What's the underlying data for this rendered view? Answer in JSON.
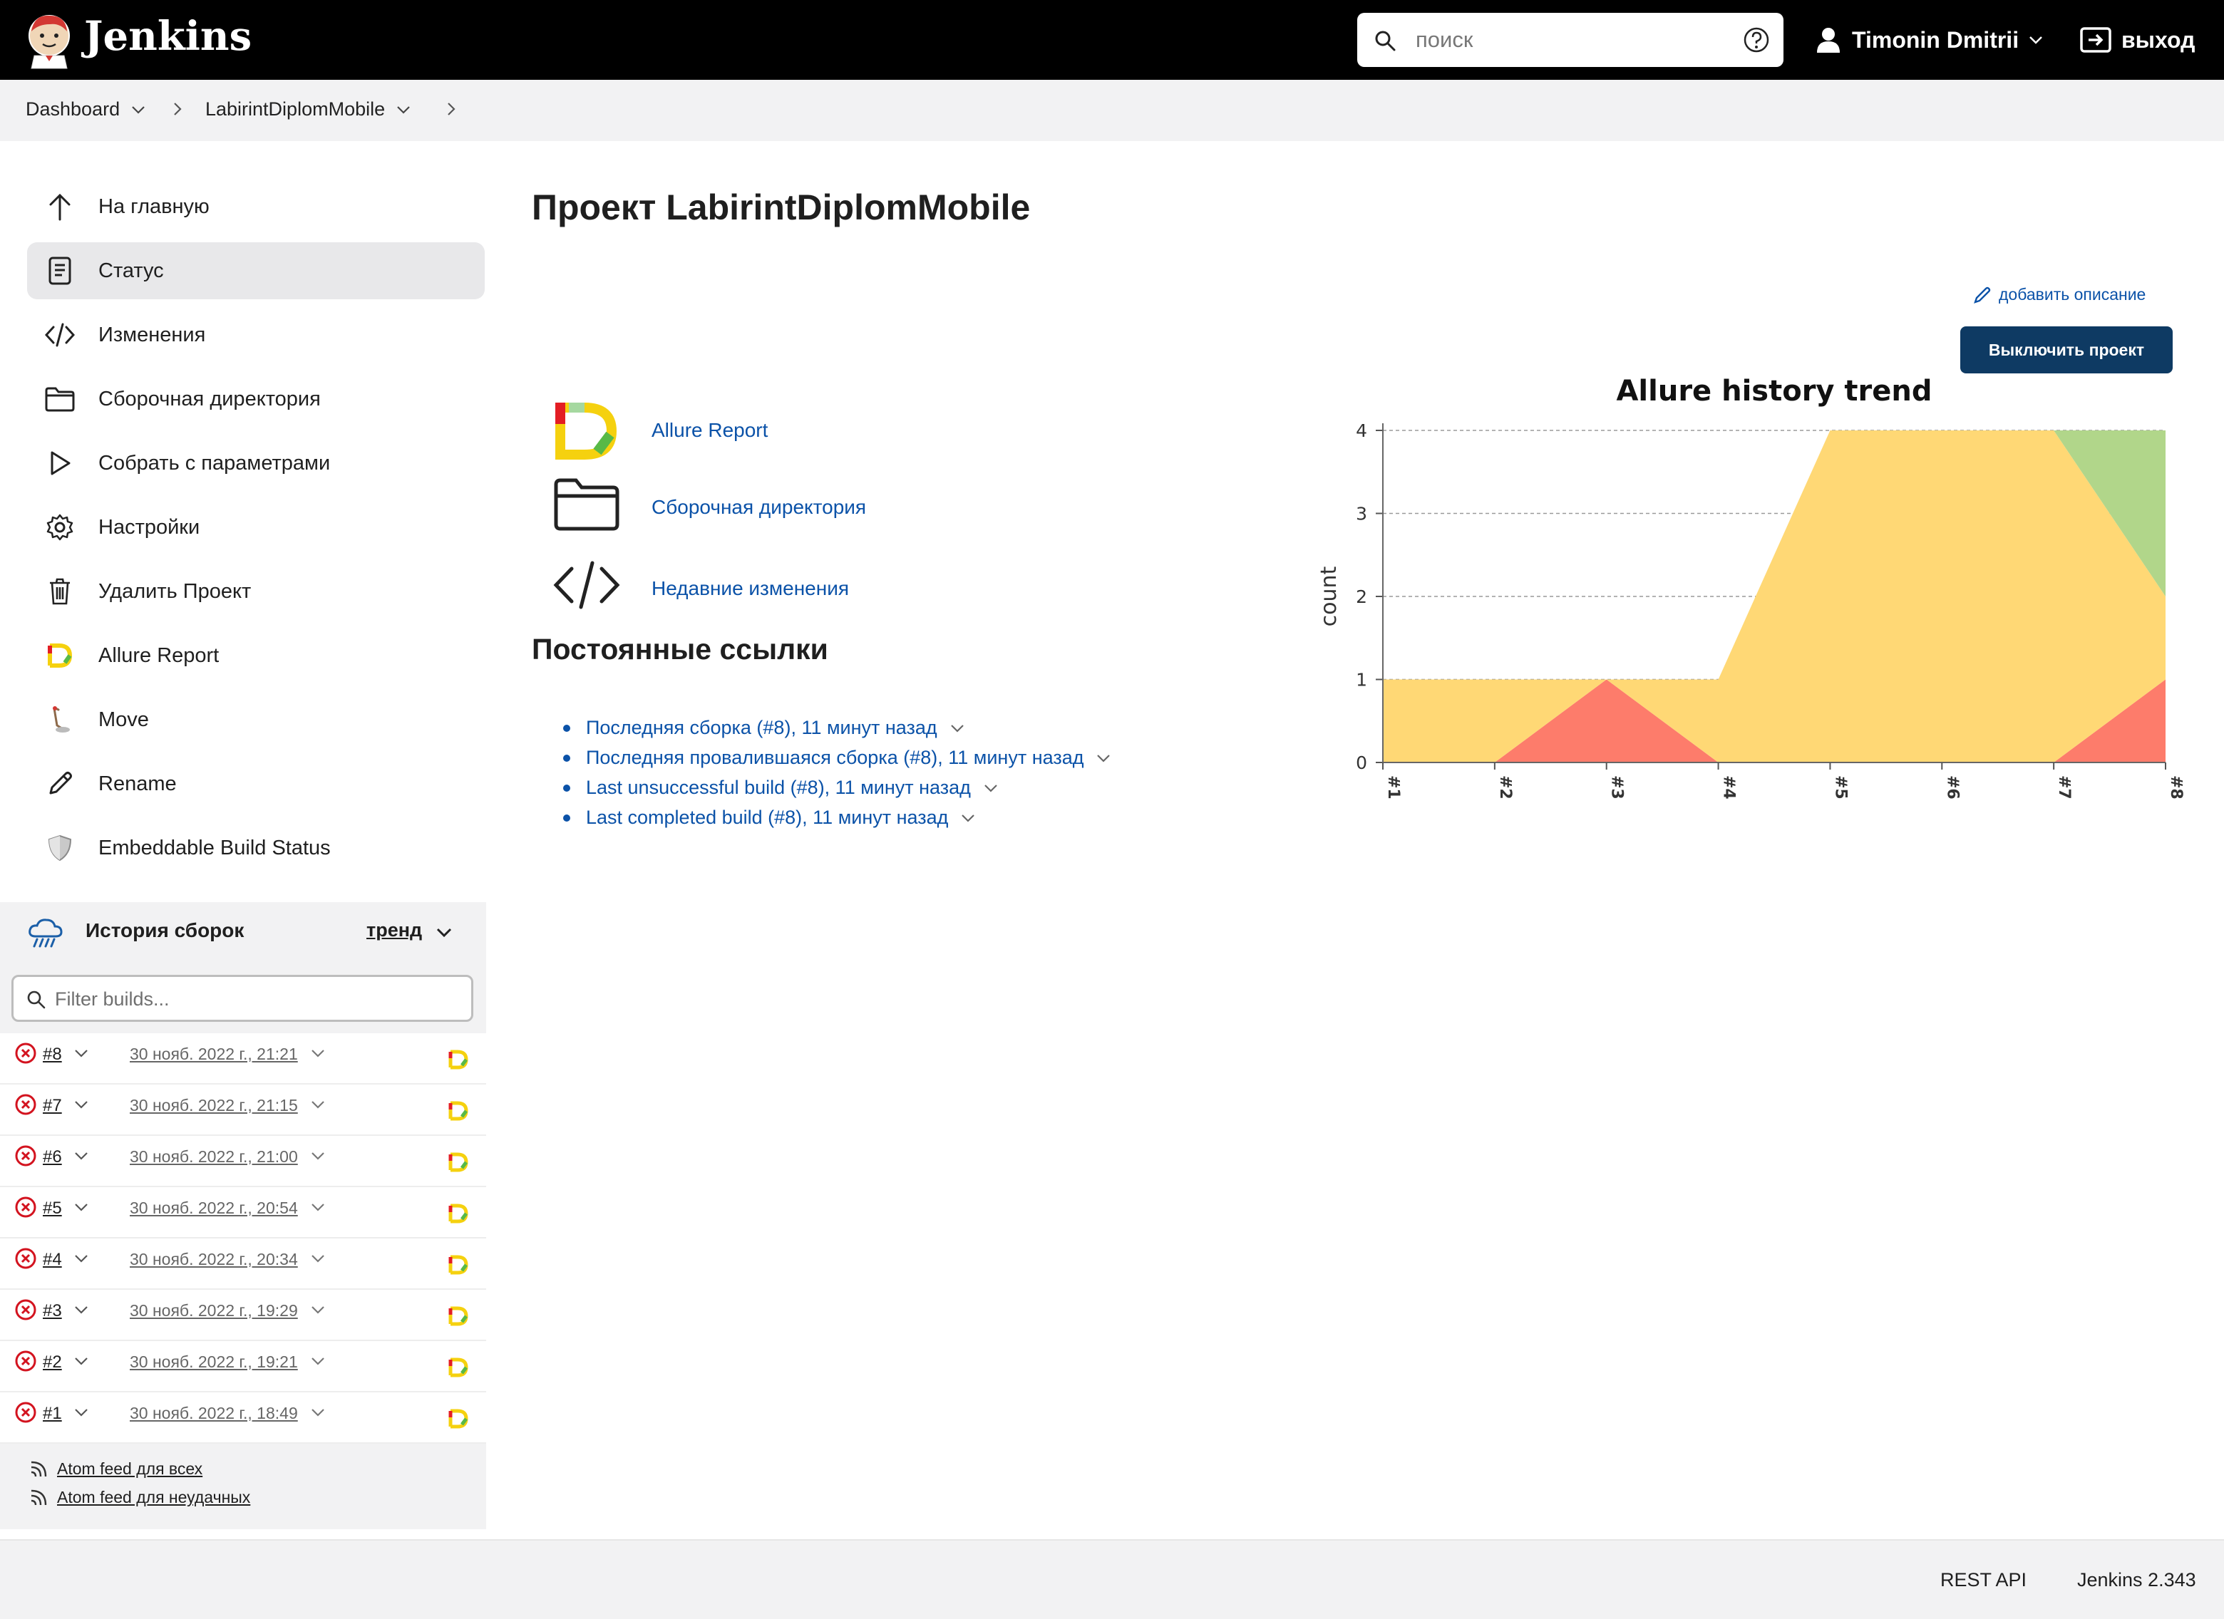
{
  "header": {
    "brand": "Jenkins",
    "search_placeholder": "поиск",
    "user_name": "Timonin Dmitrii",
    "logout": "выход"
  },
  "breadcrumb": [
    "Dashboard",
    "LabirintDiplomMobile"
  ],
  "sidebar": {
    "tasks": [
      {
        "label": "На главную",
        "icon": "arrow-up-icon"
      },
      {
        "label": "Статус",
        "icon": "document-icon"
      },
      {
        "label": "Изменения",
        "icon": "code-icon"
      },
      {
        "label": "Сборочная директория",
        "icon": "folder-icon"
      },
      {
        "label": "Собрать с параметрами",
        "icon": "play-icon"
      },
      {
        "label": "Настройки",
        "icon": "gear-icon"
      },
      {
        "label": "Удалить Проект",
        "icon": "trash-icon"
      },
      {
        "label": "Allure Report",
        "icon": "allure-icon"
      },
      {
        "label": "Move",
        "icon": "move-icon"
      },
      {
        "label": "Rename",
        "icon": "pencil-icon"
      },
      {
        "label": "Embeddable Build Status",
        "icon": "shield-icon"
      }
    ]
  },
  "build_history": {
    "title": "История сборок",
    "trend": "тренд",
    "filter_placeholder": "Filter builds...",
    "builds": [
      {
        "num": "#8",
        "date": "30 нояб. 2022 г., 21:21"
      },
      {
        "num": "#7",
        "date": "30 нояб. 2022 г., 21:15"
      },
      {
        "num": "#6",
        "date": "30 нояб. 2022 г., 21:00"
      },
      {
        "num": "#5",
        "date": "30 нояб. 2022 г., 20:54"
      },
      {
        "num": "#4",
        "date": "30 нояб. 2022 г., 20:34"
      },
      {
        "num": "#3",
        "date": "30 нояб. 2022 г., 19:29"
      },
      {
        "num": "#2",
        "date": "30 нояб. 2022 г., 19:21"
      },
      {
        "num": "#1",
        "date": "30 нояб. 2022 г., 18:49"
      }
    ],
    "feed_all": "Atom feed для всех",
    "feed_failed": "Atom feed для неудачных"
  },
  "main": {
    "title": "Проект LabirintDiplomMobile",
    "add_description": "добавить описание",
    "disable_button": "Выключить проект",
    "links": [
      "Allure Report",
      "Сборочная директория",
      "Недавние изменения"
    ],
    "permalinks_title": "Постоянные ссылки",
    "permalinks": [
      "Последняя сборка (#8), 11 минут назад",
      "Последняя провалившаяся сборка (#8), 11 минут назад",
      "Last unsuccessful build (#8), 11 минут назад",
      "Last completed build (#8), 11 минут назад"
    ]
  },
  "chart_data": {
    "type": "area",
    "title": "Allure history trend",
    "ylabel": "count",
    "x": [
      "#1",
      "#2",
      "#3",
      "#4",
      "#5",
      "#6",
      "#7",
      "#8"
    ],
    "ylim": [
      0,
      4
    ],
    "yticks": [
      "0",
      "1",
      "2",
      "3",
      "4"
    ],
    "grid": true,
    "series": [
      {
        "values": [
          0,
          0,
          1,
          0,
          0,
          0,
          0,
          1
        ],
        "color": "#fd7c6b"
      },
      {
        "values": [
          1,
          1,
          0,
          1,
          4,
          4,
          4,
          1
        ],
        "color": "#ffd875"
      },
      {
        "values": [
          0,
          0,
          0,
          0,
          0,
          0,
          0,
          2
        ],
        "color": "#b1d68a"
      }
    ]
  },
  "footer": {
    "rest_api": "REST API",
    "version": "Jenkins 2.343"
  },
  "colors": {
    "header_bg": "#000000",
    "link": "#0b52a8",
    "button": "#0e3a63",
    "failed": "#d3131f",
    "failed_area": "#fd7c6b",
    "broken_area": "#ffd875",
    "passed_area": "#b1d68a"
  }
}
